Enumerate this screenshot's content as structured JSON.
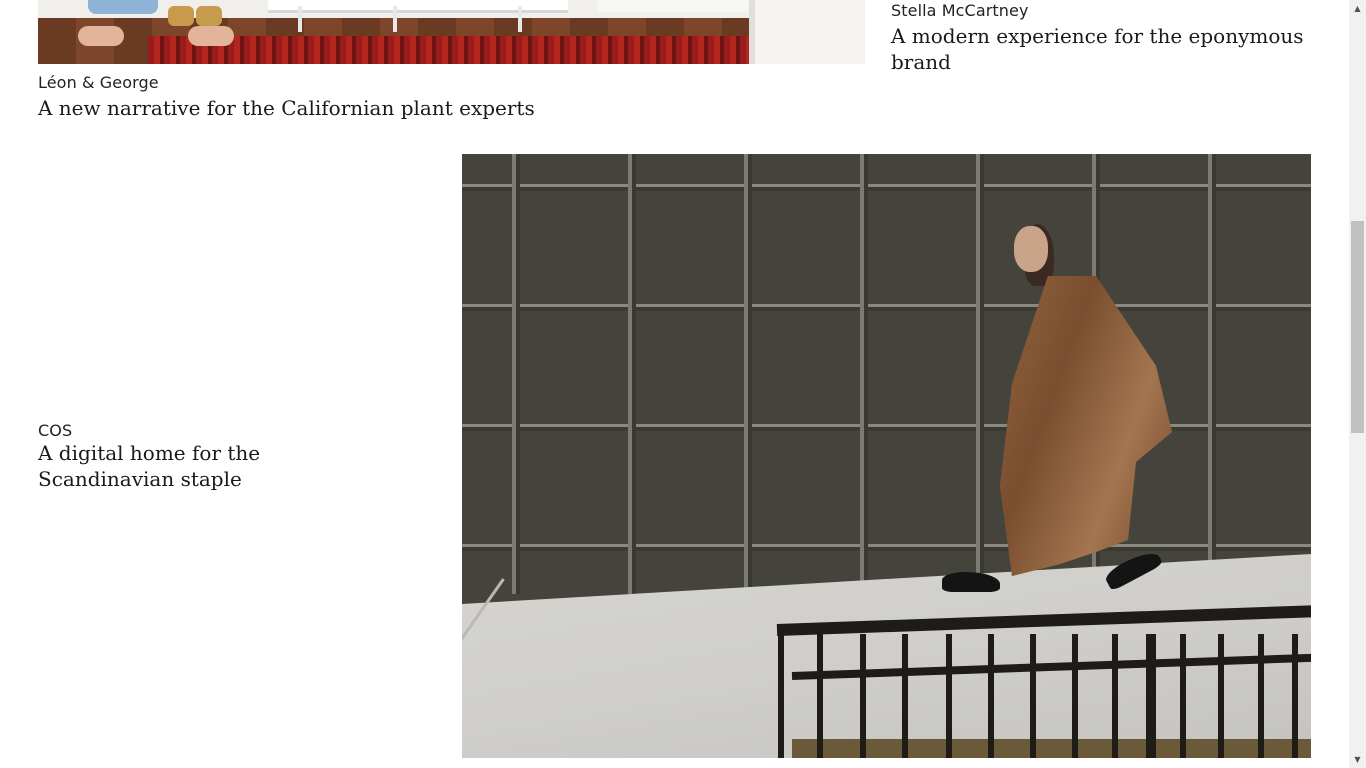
{
  "projects": [
    {
      "client": "Stella McCartney",
      "title": "A modern experience for the eponymous brand"
    },
    {
      "client": "Léon & George",
      "title": "A new narrative for the Californian plant experts",
      "image": "room-with-red-rug-and-bare-feet-photo"
    },
    {
      "client": "COS",
      "title": "A digital home for the Scandinavian staple",
      "image": "woman-in-brown-coat-walking-by-green-paneled-wall-photo"
    }
  ],
  "scrollbar": {
    "up_icon": "▲",
    "down_icon": "▼"
  }
}
